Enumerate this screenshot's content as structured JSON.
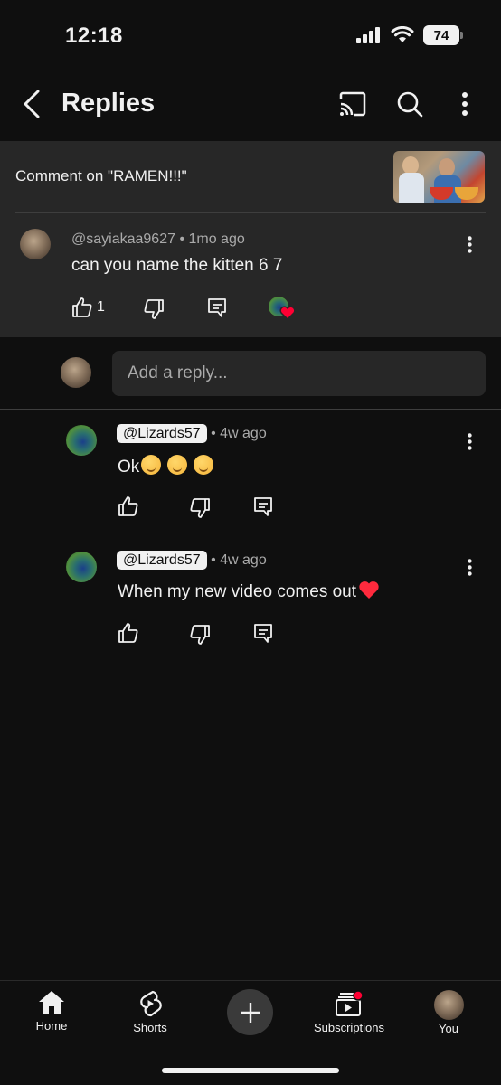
{
  "status_bar": {
    "time": "12:18",
    "battery": "74"
  },
  "header": {
    "title": "Replies"
  },
  "context": {
    "text": "Comment on \"RAMEN!!!\""
  },
  "parent_comment": {
    "handle": "@sayiakaa9627",
    "age": "1mo ago",
    "text": "can you name the kitten 6 7",
    "like_count": "1"
  },
  "reply_input": {
    "placeholder": "Add a reply..."
  },
  "replies": [
    {
      "handle": "@Lizards57",
      "age": "4w ago",
      "text": "Ok",
      "emoji": [
        "smirk-face",
        "smirk-face",
        "smirk-face"
      ]
    },
    {
      "handle": "@Lizards57",
      "age": "4w ago",
      "text": "When my new video comes out",
      "emoji": [
        "red-heart"
      ]
    }
  ],
  "nav": {
    "home": "Home",
    "shorts": "Shorts",
    "subscriptions": "Subscriptions",
    "you": "You"
  },
  "colors": {
    "background": "#0f0f0f",
    "surface": "#272727",
    "accent_red": "#ff0033"
  }
}
